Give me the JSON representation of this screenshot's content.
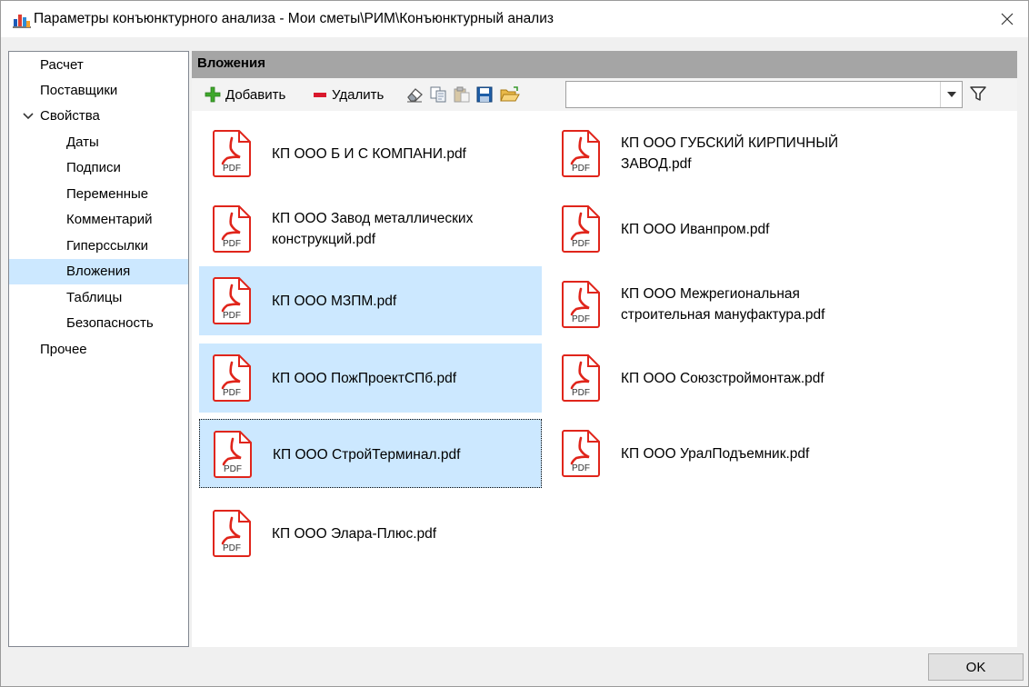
{
  "window": {
    "title": "Параметры конъюнктурного анализа - Мои сметы\\РИМ\\Конъюнктурный анализ"
  },
  "nav": {
    "items": [
      {
        "label": "Расчет"
      },
      {
        "label": "Поставщики"
      },
      {
        "label": "Свойства",
        "expanded": true
      },
      {
        "label": "Даты"
      },
      {
        "label": "Подписи"
      },
      {
        "label": "Переменные"
      },
      {
        "label": "Комментарий"
      },
      {
        "label": "Гиперссылки"
      },
      {
        "label": "Вложения",
        "selected": true
      },
      {
        "label": "Таблицы"
      },
      {
        "label": "Безопасность"
      },
      {
        "label": "Прочее"
      }
    ]
  },
  "section": {
    "title": "Вложения"
  },
  "toolbar": {
    "add_label": "Добавить",
    "delete_label": "Удалить",
    "filter_value": ""
  },
  "files": [
    {
      "name": "КП ООО Б И С КОМПАНИ.pdf",
      "icon_label": "PDF"
    },
    {
      "name": "КП ООО ГУБСКИЙ КИРПИЧНЫЙ ЗАВОД.pdf",
      "icon_label": "PDF"
    },
    {
      "name": "КП ООО Завод металлических конструкций.pdf",
      "icon_label": "PDF"
    },
    {
      "name": "КП ООО Иванпром.pdf",
      "icon_label": "PDF"
    },
    {
      "name": "КП ООО МЗПМ.pdf",
      "icon_label": "PDF",
      "selected": true
    },
    {
      "name": "КП ООО Межрегиональная строительная мануфактура.pdf",
      "icon_label": "PDF"
    },
    {
      "name": "КП ООО ПожПроектСПб.pdf",
      "icon_label": "PDF",
      "selected": true
    },
    {
      "name": "КП ООО Союзстроймонтаж.pdf",
      "icon_label": "PDF"
    },
    {
      "name": "КП ООО СтройТерминал.pdf",
      "icon_label": "PDF",
      "selected": true,
      "focused": true
    },
    {
      "name": "КП ООО УралПодъемник.pdf",
      "icon_label": "PDF"
    },
    {
      "name": "КП ООО Элара-Плюс.pdf",
      "icon_label": "PDF"
    }
  ],
  "footer": {
    "ok_label": "OK"
  },
  "colors": {
    "selection": "#cce8ff",
    "pdf_red": "#e0251b",
    "header_gray": "#a5a5a5"
  }
}
